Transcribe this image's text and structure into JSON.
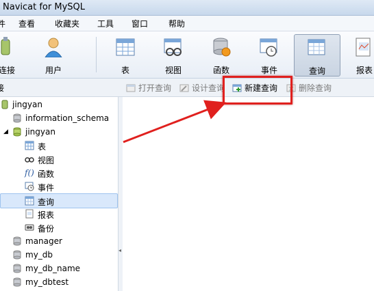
{
  "window": {
    "title": "Navicat for MySQL"
  },
  "menu": [
    "件",
    "查看",
    "收藏夹",
    "工具",
    "窗口",
    "帮助"
  ],
  "toolbar": [
    {
      "label": "连接",
      "icon": "connect-icon"
    },
    {
      "label": "用户",
      "icon": "user-icon"
    },
    {
      "label": "表",
      "icon": "table-icon"
    },
    {
      "label": "视图",
      "icon": "view-icon"
    },
    {
      "label": "函数",
      "icon": "function-icon"
    },
    {
      "label": "事件",
      "icon": "event-icon"
    },
    {
      "label": "查询",
      "icon": "query-icon",
      "active": true
    },
    {
      "label": "报表",
      "icon": "report-icon"
    }
  ],
  "objbar": {
    "pane_label": "接",
    "open_query": "打开查询",
    "design_query": "设计查询",
    "new_query": "新建查询",
    "delete_query": "删除查询"
  },
  "tree": {
    "connection": "jingyan",
    "databases": [
      {
        "name": "information_schema"
      },
      {
        "name": "jingyan",
        "children": [
          {
            "label": "表",
            "icon": "table-icon"
          },
          {
            "label": "视图",
            "icon": "view-icon"
          },
          {
            "label": "函数",
            "icon": "function-icon"
          },
          {
            "label": "事件",
            "icon": "event-icon"
          },
          {
            "label": "查询",
            "icon": "query-icon",
            "selected": true
          },
          {
            "label": "报表",
            "icon": "report-icon"
          },
          {
            "label": "备份",
            "icon": "backup-icon"
          }
        ]
      },
      {
        "name": "manager"
      },
      {
        "name": "my_db"
      },
      {
        "name": "my_db_name"
      },
      {
        "name": "my_dbtest"
      }
    ]
  },
  "colors": {
    "annotation": "#e0201e",
    "selection": "#d9e8fb"
  }
}
